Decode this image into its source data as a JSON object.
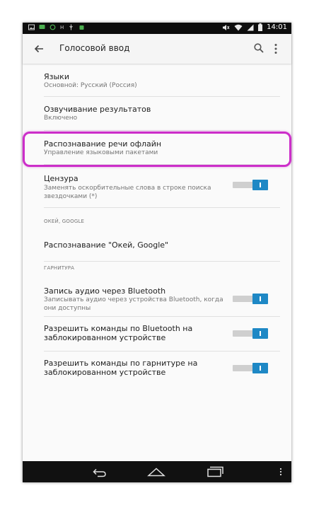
{
  "status_bar": {
    "time": "14:01",
    "left_icons": [
      "gallery-icon",
      "message-icon",
      "sync-icon",
      "h-plus-icon",
      "usb-icon",
      "android-icon"
    ],
    "h_plus_label": "H",
    "right_icons": [
      "mute-icon",
      "wifi-icon",
      "signal-icon",
      "battery-icon"
    ]
  },
  "toolbar": {
    "title": "Голосовой ввод",
    "back_icon": "arrow-back-icon",
    "search_icon": "search-icon",
    "more_icon": "more-vert-icon"
  },
  "settings": {
    "languages": {
      "title": "Языки",
      "subtitle": "Основной: Русский (Россия)"
    },
    "speech_output": {
      "title": "Озвучивание результатов",
      "subtitle": "Включено"
    },
    "offline": {
      "title": "Распознавание речи офлайн",
      "subtitle": "Управление языковыми пакетами"
    },
    "censor": {
      "title": "Цензура",
      "subtitle_line1": "Заменять оскорбительные слова в строке поиска",
      "subtitle_line2": "звездочками (*)",
      "enabled": true
    },
    "section_ok_google": "ОКЕЙ, GOOGLE",
    "ok_google": {
      "title": "Распознавание \"Окей, Google\""
    },
    "section_headset": "ГАРНИТУРА",
    "bt_audio": {
      "title": "Запись аудио через Bluetooth",
      "subtitle_line1": "Записывать аудио через устройства Bluetooth, когда",
      "subtitle_line2": "они доступны",
      "enabled": true
    },
    "bt_locked": {
      "title_line1": "Разрешить команды по Bluetooth на",
      "title_line2": "заблокированном устройстве",
      "enabled": true
    },
    "headset_locked": {
      "title_line1": "Разрешить команды по гарнитуре на",
      "title_line2": "заблокированном устройстве",
      "enabled": true
    }
  },
  "colors": {
    "highlight": "#cc2ec9",
    "toggle_on": "#1e88c5"
  },
  "nav_bar": {
    "icons": [
      "nav-back-icon",
      "nav-home-icon",
      "nav-recent-icon",
      "nav-menu-icon"
    ]
  }
}
